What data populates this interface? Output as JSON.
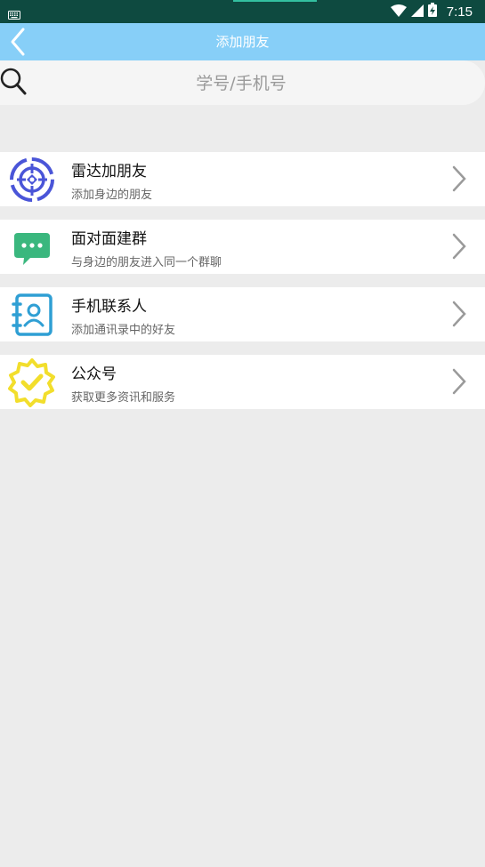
{
  "status_bar": {
    "time": "7:15",
    "icons": [
      "keyboard-icon",
      "wifi-icon",
      "signal-icon",
      "battery-charging-icon"
    ]
  },
  "header": {
    "title": "添加朋友",
    "back_icon": "chevron-left-icon"
  },
  "search": {
    "placeholder": "学号/手机号",
    "icon": "search-icon"
  },
  "menu": {
    "items": [
      {
        "title": "雷达加朋友",
        "subtitle": "添加身边的朋友",
        "icon": "radar-icon"
      },
      {
        "title": "面对面建群",
        "subtitle": "与身边的朋友进入同一个群聊",
        "icon": "chat-bubble-icon"
      },
      {
        "title": "手机联系人",
        "subtitle": "添加通讯录中的好友",
        "icon": "contacts-book-icon"
      },
      {
        "title": "公众号",
        "subtitle": "获取更多资讯和服务",
        "icon": "verified-badge-icon"
      }
    ]
  },
  "colors": {
    "status_bar": "#0e4a40",
    "title_bar": "#87cff8",
    "background": "#ececec",
    "radar": "#4a55d8",
    "chat": "#3ab77e",
    "contacts": "#2f9fd4",
    "badge": "#f2de2c"
  }
}
